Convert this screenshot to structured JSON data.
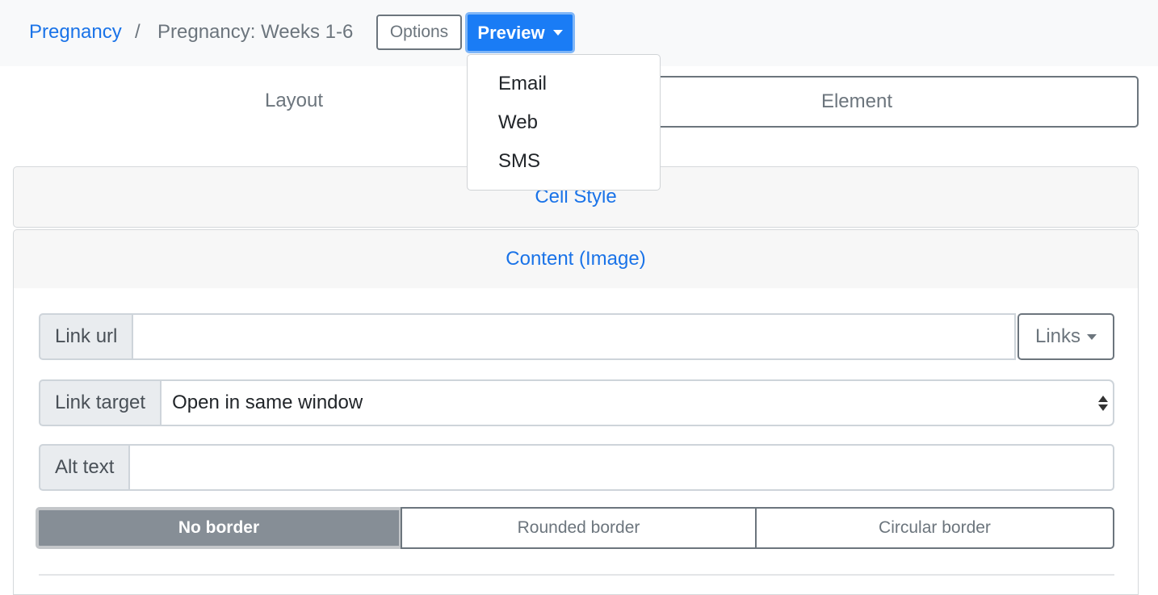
{
  "breadcrumb": {
    "root": "Pregnancy",
    "separator": "/",
    "current": "Pregnancy: Weeks 1-6"
  },
  "toolbar": {
    "options_label": "Options",
    "preview_label": "Preview"
  },
  "preview_menu": {
    "items": [
      "Email",
      "Web",
      "SMS"
    ]
  },
  "tabs": {
    "layout": "Layout",
    "element": "Element"
  },
  "panels": {
    "cell_style": "Cell Style",
    "content": "Content (Image)"
  },
  "form": {
    "link_url_label": "Link url",
    "link_url_value": "",
    "links_button": "Links",
    "link_target_label": "Link target",
    "link_target_value": "Open in same window",
    "alt_text_label": "Alt text",
    "alt_text_value": ""
  },
  "border_styles": {
    "options": [
      "No border",
      "Rounded border",
      "Circular border"
    ],
    "selected": "No border"
  },
  "colors": {
    "primary": "#1a7cf5",
    "link": "#1a73e8",
    "secondary": "#6c757d",
    "active_segment": "#868e96"
  }
}
